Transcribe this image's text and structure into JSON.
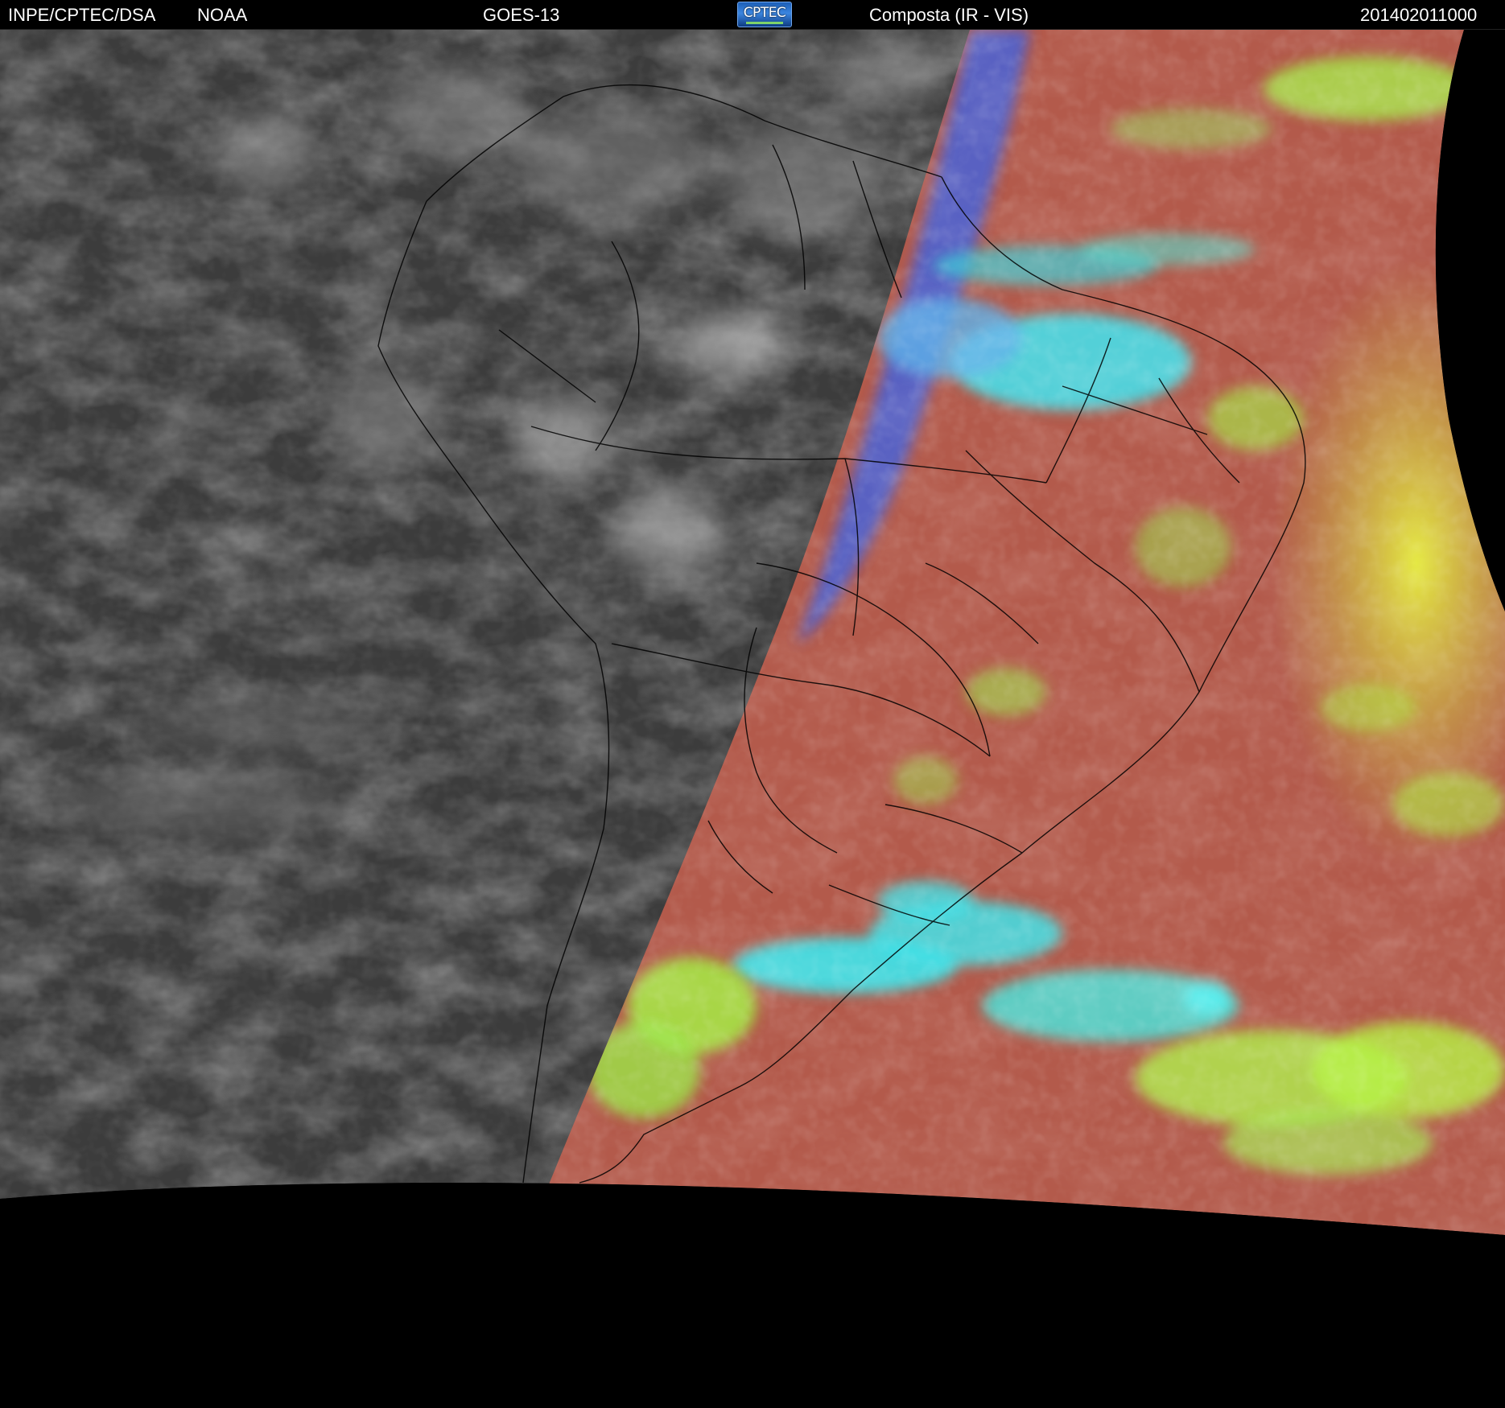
{
  "header": {
    "agency": "INPE/CPTEC/DSA",
    "source": "NOAA",
    "satellite": "GOES-13",
    "logo_text": "CPTEC",
    "product": "Composta (IR - VIS)",
    "timestamp": "201402011000"
  },
  "colors": {
    "background": "#000000",
    "ir_gray": "#3f3f3f",
    "composite_red": "#b5594a",
    "cloud_cyan": "#3ee6e6",
    "cloud_green": "#a8f040",
    "cloud_blue": "#4a6ae8",
    "border_lines": "#000000"
  }
}
